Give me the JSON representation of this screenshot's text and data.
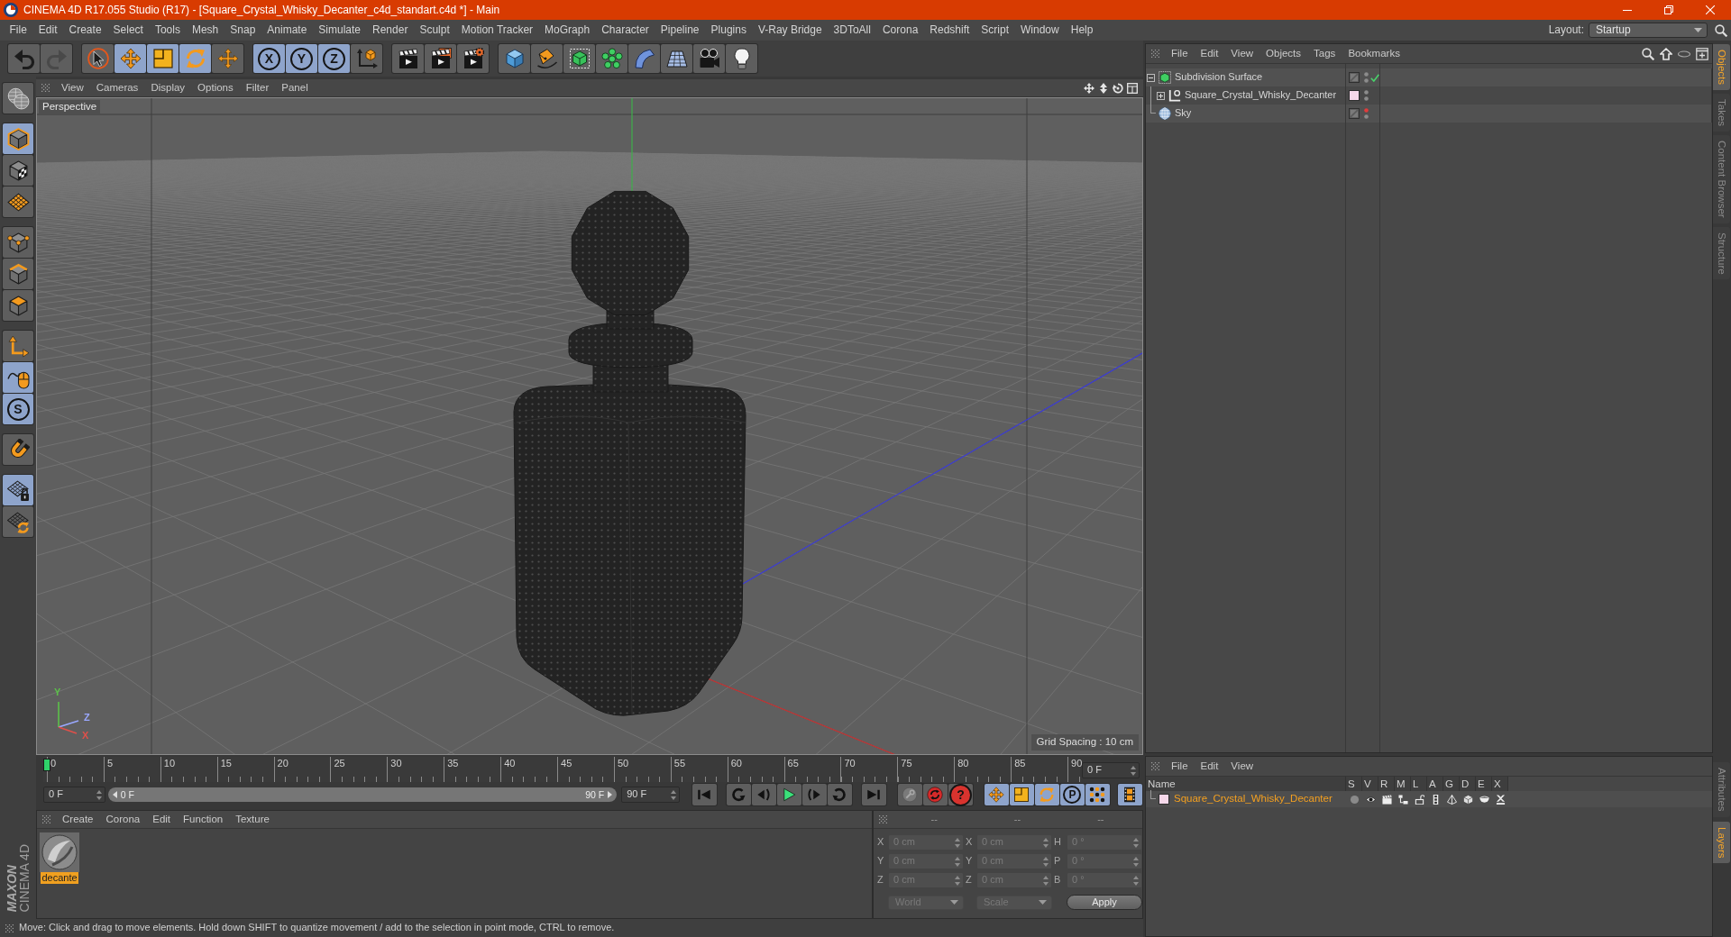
{
  "window": {
    "title": "CINEMA 4D R17.055 Studio (R17) - [Square_Crystal_Whisky_Decanter_c4d_standart.c4d *] - Main"
  },
  "menu_bar": {
    "items": [
      "File",
      "Edit",
      "Create",
      "Select",
      "Tools",
      "Mesh",
      "Snap",
      "Animate",
      "Simulate",
      "Render",
      "Sculpt",
      "Motion Tracker",
      "MoGraph",
      "Character",
      "Pipeline",
      "Plugins",
      "V-Ray Bridge",
      "3DToAll",
      "Corona",
      "Redshift",
      "Script",
      "Window",
      "Help"
    ],
    "layout_label": "Layout:",
    "layout_value": "Startup"
  },
  "toolbar": {
    "groups": [
      [
        {
          "kind": "undo",
          "selected": false,
          "disabled": false
        },
        {
          "kind": "redo",
          "selected": false,
          "disabled": true
        }
      ],
      [
        {
          "kind": "live_select",
          "selected": false
        },
        {
          "kind": "move",
          "selected": true
        },
        {
          "kind": "scale",
          "selected": true
        },
        {
          "kind": "rotate",
          "selected": true
        },
        {
          "kind": "transform",
          "selected": false
        }
      ],
      [
        {
          "kind": "axis",
          "label": "X",
          "selected": true
        },
        {
          "kind": "axis",
          "label": "Y",
          "selected": true
        },
        {
          "kind": "axis",
          "label": "Z",
          "selected": true
        },
        {
          "kind": "coordinates",
          "selected": false
        }
      ],
      [
        {
          "kind": "render_view",
          "selected": false
        },
        {
          "kind": "render_picture",
          "selected": false
        },
        {
          "kind": "render_settings",
          "selected": false
        }
      ],
      [
        {
          "kind": "cube",
          "selected": false
        },
        {
          "kind": "pen",
          "selected": false
        },
        {
          "kind": "subdivision",
          "selected": false
        },
        {
          "kind": "cloner",
          "selected": false
        },
        {
          "kind": "bend",
          "selected": false
        },
        {
          "kind": "floor",
          "selected": false
        },
        {
          "kind": "camera",
          "selected": false
        },
        {
          "kind": "light",
          "selected": false
        }
      ]
    ]
  },
  "left_toolbar": {
    "groups": [
      [
        {
          "kind": "make_editable",
          "selected": false
        }
      ],
      [
        {
          "kind": "model",
          "selected": true
        },
        {
          "kind": "texture",
          "selected": false
        },
        {
          "kind": "workplane",
          "selected": false
        }
      ],
      [
        {
          "kind": "points",
          "selected": false
        },
        {
          "kind": "edges",
          "selected": false
        },
        {
          "kind": "polygons",
          "selected": false
        }
      ],
      [
        {
          "kind": "axis_mode",
          "selected": false
        },
        {
          "kind": "tweak",
          "selected": true
        },
        {
          "kind": "solo",
          "label": "S",
          "selected": true
        }
      ],
      [
        {
          "kind": "snap",
          "selected": false
        }
      ],
      [
        {
          "kind": "workplane_lock",
          "selected": true
        },
        {
          "kind": "grid_sync",
          "selected": false
        }
      ]
    ]
  },
  "viewport": {
    "menu": [
      "View",
      "Cameras",
      "Display",
      "Options",
      "Filter",
      "Panel"
    ],
    "camera": "Perspective",
    "grid_spacing": "Grid Spacing : 10 cm",
    "axis_gizmo": [
      {
        "label": "Y",
        "color": "#5cc04a"
      },
      {
        "label": "Z",
        "color": "#9aa8ff"
      },
      {
        "label": "X",
        "color": "#e0504a"
      }
    ]
  },
  "timeline": {
    "frames": [
      "0",
      "5",
      "10",
      "15",
      "20",
      "25",
      "30",
      "35",
      "40",
      "45",
      "50",
      "55",
      "60",
      "65",
      "70",
      "75",
      "80",
      "85",
      "90"
    ],
    "playhead": {
      "level": 0
    },
    "current_frame": "0 F",
    "start_frame": "0 F",
    "range": {
      "level": 1,
      "start": "0 F",
      "end": "90 F"
    },
    "end_frame": "90 F",
    "button_groups": [
      [
        {
          "kind": "go_start"
        }
      ],
      [
        {
          "kind": "prev_key"
        },
        {
          "kind": "prev_frame"
        },
        {
          "kind": "play"
        },
        {
          "kind": "next_frame"
        },
        {
          "kind": "next_key"
        }
      ],
      [
        {
          "kind": "go_end"
        }
      ],
      [
        {
          "kind": "key"
        },
        {
          "kind": "autokey"
        },
        {
          "kind": "help",
          "label": "?"
        }
      ],
      [
        {
          "kind": "position",
          "selected": true
        },
        {
          "kind": "scale_key",
          "selected": true
        },
        {
          "kind": "rotation",
          "selected": true
        },
        {
          "kind": "parameter",
          "label": "P",
          "selected": true
        },
        {
          "kind": "pla",
          "selected": true
        }
      ],
      [
        {
          "kind": "timeline_view",
          "selected": true
        }
      ]
    ]
  },
  "material_manager": {
    "menu": [
      "Create",
      "Corona",
      "Edit",
      "Function",
      "Texture"
    ],
    "materials": [
      {
        "name": "decante",
        "selected": true
      }
    ]
  },
  "coordinates": {
    "headers": [
      "--",
      "--",
      "--"
    ],
    "rows": [
      [
        {
          "label": "X",
          "value": "0 cm"
        },
        {
          "label": "X",
          "value": "0 cm"
        },
        {
          "label": "H",
          "value": "0 °"
        }
      ],
      [
        {
          "label": "Y",
          "value": "0 cm"
        },
        {
          "label": "Y",
          "value": "0 cm"
        },
        {
          "label": "P",
          "value": "0 °"
        }
      ],
      [
        {
          "label": "Z",
          "value": "0 cm"
        },
        {
          "label": "Z",
          "value": "0 cm"
        },
        {
          "label": "B",
          "value": "0 °"
        }
      ]
    ],
    "dropdowns": [
      "World",
      "Scale"
    ],
    "apply": "Apply",
    "disabled": true
  },
  "status_bar": {
    "text": "Move: Click and drag to move elements. Hold down SHIFT to quantize movement / add to the selection in point mode, CTRL to remove."
  },
  "branding": {
    "maker": "MAXON",
    "product": "CINEMA 4D"
  },
  "object_manager": {
    "menu": [
      "File",
      "Edit",
      "View",
      "Objects",
      "Tags",
      "Bookmarks"
    ],
    "objects": [
      {
        "kind": "subdivision",
        "name": "Subdivision Surface",
        "selected": false,
        "expanded": true,
        "visible_in_editor": true,
        "enabled": true,
        "children": [
          {
            "kind": "null",
            "name": "Square_Crystal_Whisky_Decanter",
            "selected": false,
            "expanded": false,
            "color": "#f6d8ea",
            "visible_in_editor": true,
            "enabled": false
          }
        ]
      },
      {
        "kind": "sky",
        "name": "Sky",
        "selected": false,
        "visible_in_editor": false,
        "enabled": false
      }
    ]
  },
  "layer_manager": {
    "menu": [
      "File",
      "Edit",
      "View"
    ],
    "columns": [
      "Name",
      "S",
      "V",
      "R",
      "M",
      "L",
      "A",
      "G",
      "D",
      "E",
      "X"
    ],
    "layers": [
      {
        "name": "Square_Crystal_Whisky_Decanter",
        "color": "#f6d8ea",
        "selected": true,
        "solo": false,
        "visible": true,
        "render": true,
        "manager": true,
        "locked": false,
        "animation": true,
        "generators": true,
        "deformers": true,
        "expressions": true,
        "xrefs": true
      }
    ]
  },
  "side_tabs": {
    "top": [
      {
        "label": "Objects",
        "selected": true
      },
      {
        "label": "Takes",
        "selected": false
      },
      {
        "label": "Content Browser",
        "selected": false
      },
      {
        "label": "Structure",
        "selected": false
      }
    ],
    "bottom": [
      {
        "label": "Attributes",
        "selected": false
      },
      {
        "label": "Layers",
        "selected": true
      }
    ]
  }
}
